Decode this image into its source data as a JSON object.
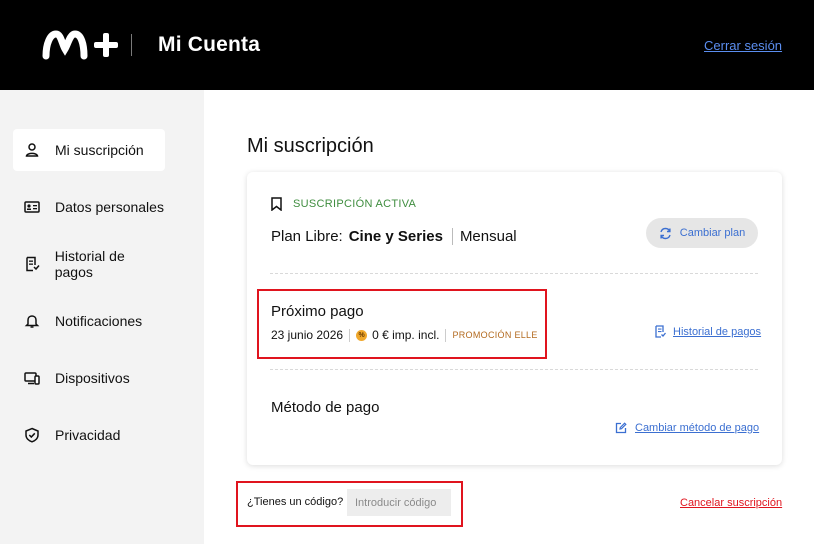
{
  "header": {
    "brand": "Mi Cuenta",
    "logo_icon": "movistar-plus-logo",
    "logout_label": "Cerrar sesión"
  },
  "sidebar": {
    "items": [
      {
        "label": "Mi suscripción",
        "icon": "user-icon",
        "active": true
      },
      {
        "label": "Datos personales",
        "icon": "id-card-icon",
        "active": false
      },
      {
        "label": "Historial de pagos",
        "icon": "receipt-icon",
        "active": false
      },
      {
        "label": "Notificaciones",
        "icon": "bell-icon",
        "active": false
      },
      {
        "label": "Dispositivos",
        "icon": "devices-icon",
        "active": false
      },
      {
        "label": "Privacidad",
        "icon": "shield-icon",
        "active": false
      }
    ]
  },
  "main": {
    "title": "Mi suscripción",
    "subscription": {
      "status": "SUSCRIPCIÓN ACTIVA",
      "plan_prefix": "Plan Libre:",
      "plan_name": "Cine y Series",
      "billing": "Mensual",
      "change_plan_label": "Cambiar plan"
    },
    "next_payment": {
      "title": "Próximo pago",
      "date": "23 junio 2026",
      "amount": "0 € imp. incl.",
      "promo": "PROMOCIÓN ELLE",
      "history_link": "Historial de pagos"
    },
    "payment_method": {
      "title": "Método de pago",
      "change_link": "Cambiar método de pago"
    },
    "code": {
      "label": "¿Tienes un código?",
      "placeholder": "Introducir código"
    },
    "cancel_label": "Cancelar suscripción"
  },
  "colors": {
    "header_bg": "#000000",
    "accent_link": "#3b6fd1",
    "status_green": "#3f8d3f",
    "promo_orange": "#b36a1f",
    "cancel_red": "#e0141e"
  }
}
